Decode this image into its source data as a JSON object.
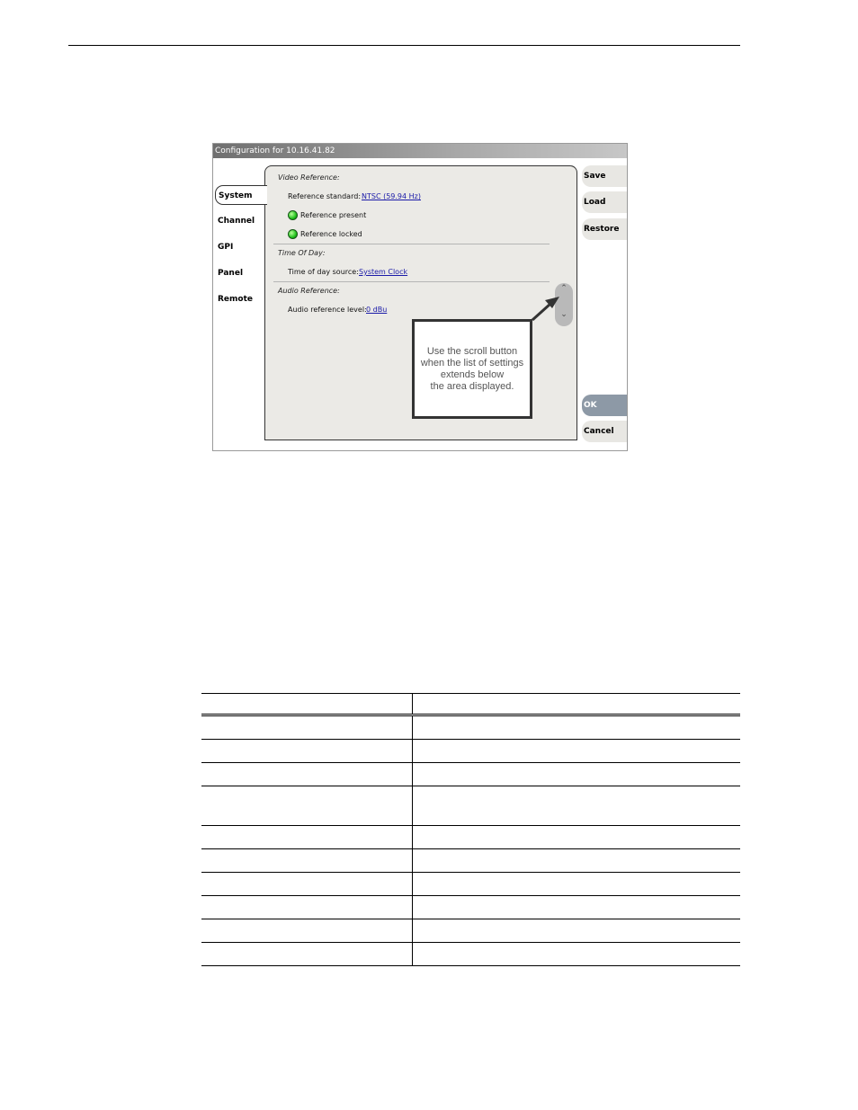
{
  "window": {
    "title": "Configuration for 10.16.41.82"
  },
  "tabs": [
    {
      "label": "System",
      "active": true
    },
    {
      "label": "Channel",
      "active": false
    },
    {
      "label": "GPI",
      "active": false
    },
    {
      "label": "Panel",
      "active": false
    },
    {
      "label": "Remote",
      "active": false
    }
  ],
  "video_reference": {
    "heading": "Video Reference:",
    "standard_label": "Reference standard:",
    "standard_value": "NTSC (59.94 Hz)",
    "present_label": "Reference present",
    "locked_label": "Reference locked"
  },
  "time_of_day": {
    "heading": "Time Of Day:",
    "source_label": "Time of day source:",
    "source_value": "System Clock"
  },
  "audio_reference": {
    "heading": "Audio Reference:",
    "level_label": "Audio reference level:",
    "level_value": "0 dBu"
  },
  "buttons": {
    "save": "Save",
    "load": "Load",
    "restore": "Restore",
    "ok": "OK",
    "cancel": "Cancel"
  },
  "scroll": {
    "up": "⌃",
    "down": "⌄"
  },
  "callout": {
    "text": "Use the scroll button\nwhen the list of settings\nextends below\nthe area displayed."
  },
  "table": {
    "row_count": 12
  }
}
